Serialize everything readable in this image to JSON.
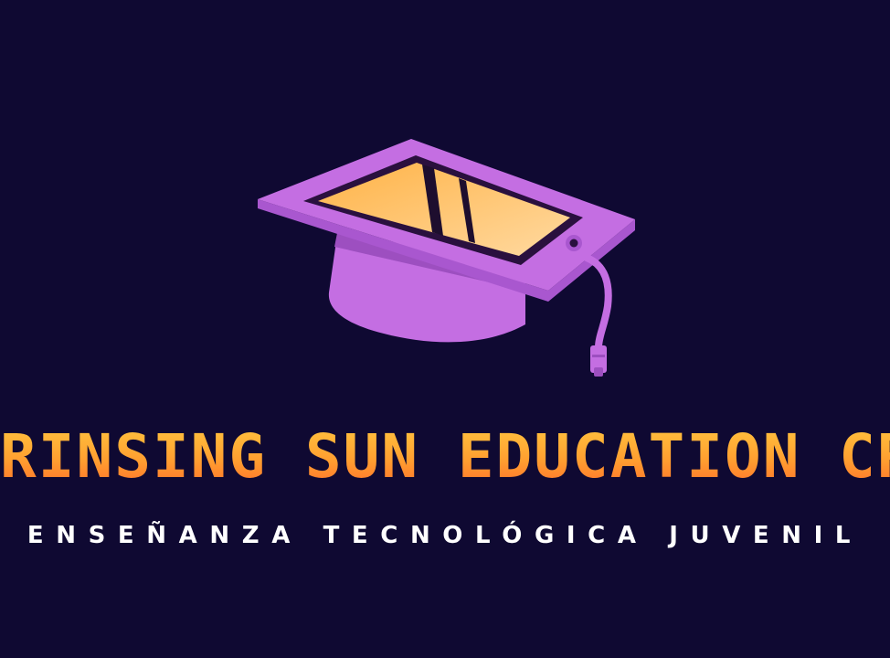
{
  "logo": {
    "icon": "graduation-cap-tablet-icon",
    "title": "RINSING SUN EDUCATION CR",
    "tagline": "ENSEÑANZA TECNOLÓGICA JUVENIL"
  },
  "colors": {
    "background": "#0f0932",
    "cap_purple": "#c46ee2",
    "cap_purple_dark": "#9d4fc0",
    "screen_gradient_top": "#ffb347",
    "screen_gradient_bottom": "#ffd9a0",
    "title_gradient_top": "#ffc840",
    "title_gradient_bottom": "#ff6a2a",
    "tagline": "#ffffff"
  }
}
